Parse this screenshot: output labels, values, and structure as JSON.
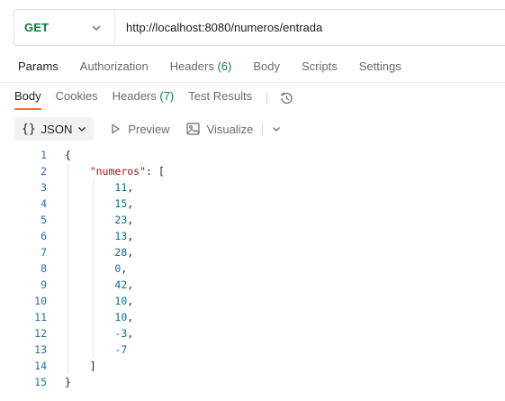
{
  "request": {
    "method": "GET",
    "url": "http://localhost:8080/numeros/entrada"
  },
  "request_tabs": [
    {
      "label": "Params",
      "count": ""
    },
    {
      "label": "Authorization",
      "count": ""
    },
    {
      "label": "Headers",
      "count": "(6)"
    },
    {
      "label": "Body",
      "count": ""
    },
    {
      "label": "Scripts",
      "count": ""
    },
    {
      "label": "Settings",
      "count": ""
    }
  ],
  "response_tabs": [
    {
      "label": "Body",
      "count": ""
    },
    {
      "label": "Cookies",
      "count": ""
    },
    {
      "label": "Headers",
      "count": "(7)"
    },
    {
      "label": "Test Results",
      "count": ""
    }
  ],
  "format_bar": {
    "braces": "{}",
    "format": "JSON",
    "preview": "Preview",
    "visualize": "Visualize"
  },
  "code": {
    "key": "\"numeros\"",
    "values": [
      "11",
      "15",
      "23",
      "13",
      "28",
      "0",
      "42",
      "10",
      "10",
      "-3",
      "-7"
    ]
  },
  "colors": {
    "method_get": "#0a7d3b",
    "active_tab_underline": "#ff6c37",
    "line_number": "#2a6fa8",
    "json_key": "#a31515"
  }
}
